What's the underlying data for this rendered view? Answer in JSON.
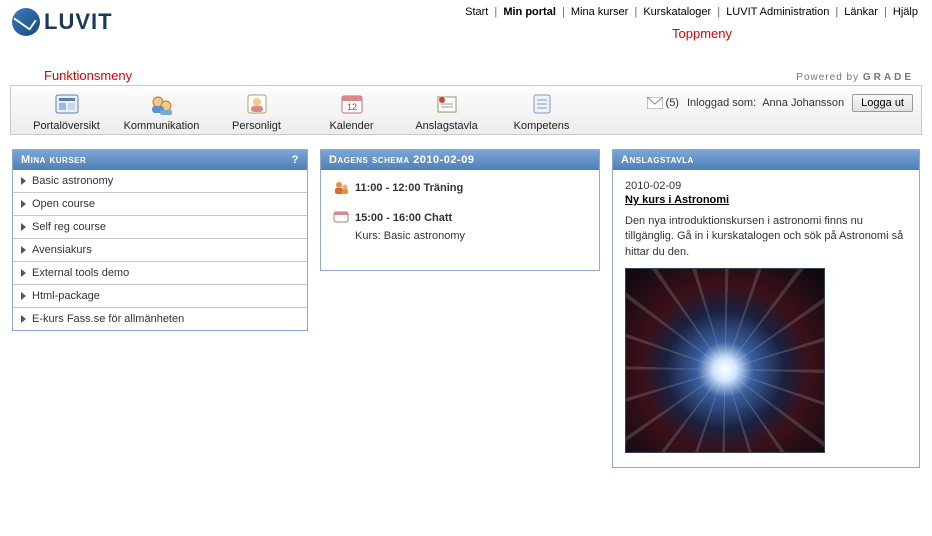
{
  "logo": {
    "text": "LUVIT"
  },
  "topnav": {
    "items": [
      {
        "label": "Start",
        "active": false
      },
      {
        "label": "Min portal",
        "active": true
      },
      {
        "label": "Mina kurser",
        "active": false
      },
      {
        "label": "Kurskataloger",
        "active": false
      },
      {
        "label": "LUVIT Administration",
        "active": false
      },
      {
        "label": "Länkar",
        "active": false
      },
      {
        "label": "Hjälp",
        "active": false
      }
    ]
  },
  "annotations": {
    "topmenu": "Toppmeny",
    "funcmenu": "Funktionsmeny"
  },
  "powered": {
    "prefix": "Powered by ",
    "brand": "GRADE"
  },
  "funcbar": {
    "items": [
      {
        "key": "overview",
        "label": "Portalöversikt"
      },
      {
        "key": "comm",
        "label": "Kommunikation"
      },
      {
        "key": "personal",
        "label": "Personligt"
      },
      {
        "key": "calendar",
        "label": "Kalender"
      },
      {
        "key": "board",
        "label": "Anslagstavla"
      },
      {
        "key": "competence",
        "label": "Kompetens"
      }
    ],
    "msg_count": "(5)",
    "login_prefix": "Inloggad som:",
    "login_user": "Anna Johansson",
    "logout": "Logga ut"
  },
  "col1": {
    "title": "Mina kurser",
    "help": "?",
    "courses": [
      "Basic astronomy",
      "Open course",
      "Self reg course",
      "Avensiakurs",
      "External tools demo",
      "Html-package",
      "E-kurs Fass.se för allmänheten"
    ]
  },
  "col2": {
    "title": "Dagens schema 2010-02-09",
    "items": [
      {
        "icon": "training",
        "time": "11:00 - 12:00 Träning",
        "sub": ""
      },
      {
        "icon": "chat",
        "time": "15:00 - 16:00 Chatt",
        "sub": "Kurs: Basic astronomy"
      }
    ]
  },
  "col3": {
    "title": "Anslagstavla",
    "post": {
      "date": "2010-02-09",
      "headline": "Ny kurs i Astronomi",
      "body": "Den nya introduktionskursen i astronomi finns nu tillgänglig. Gå in i kurskatalogen och sök på Astronomi så hittar du den."
    }
  }
}
